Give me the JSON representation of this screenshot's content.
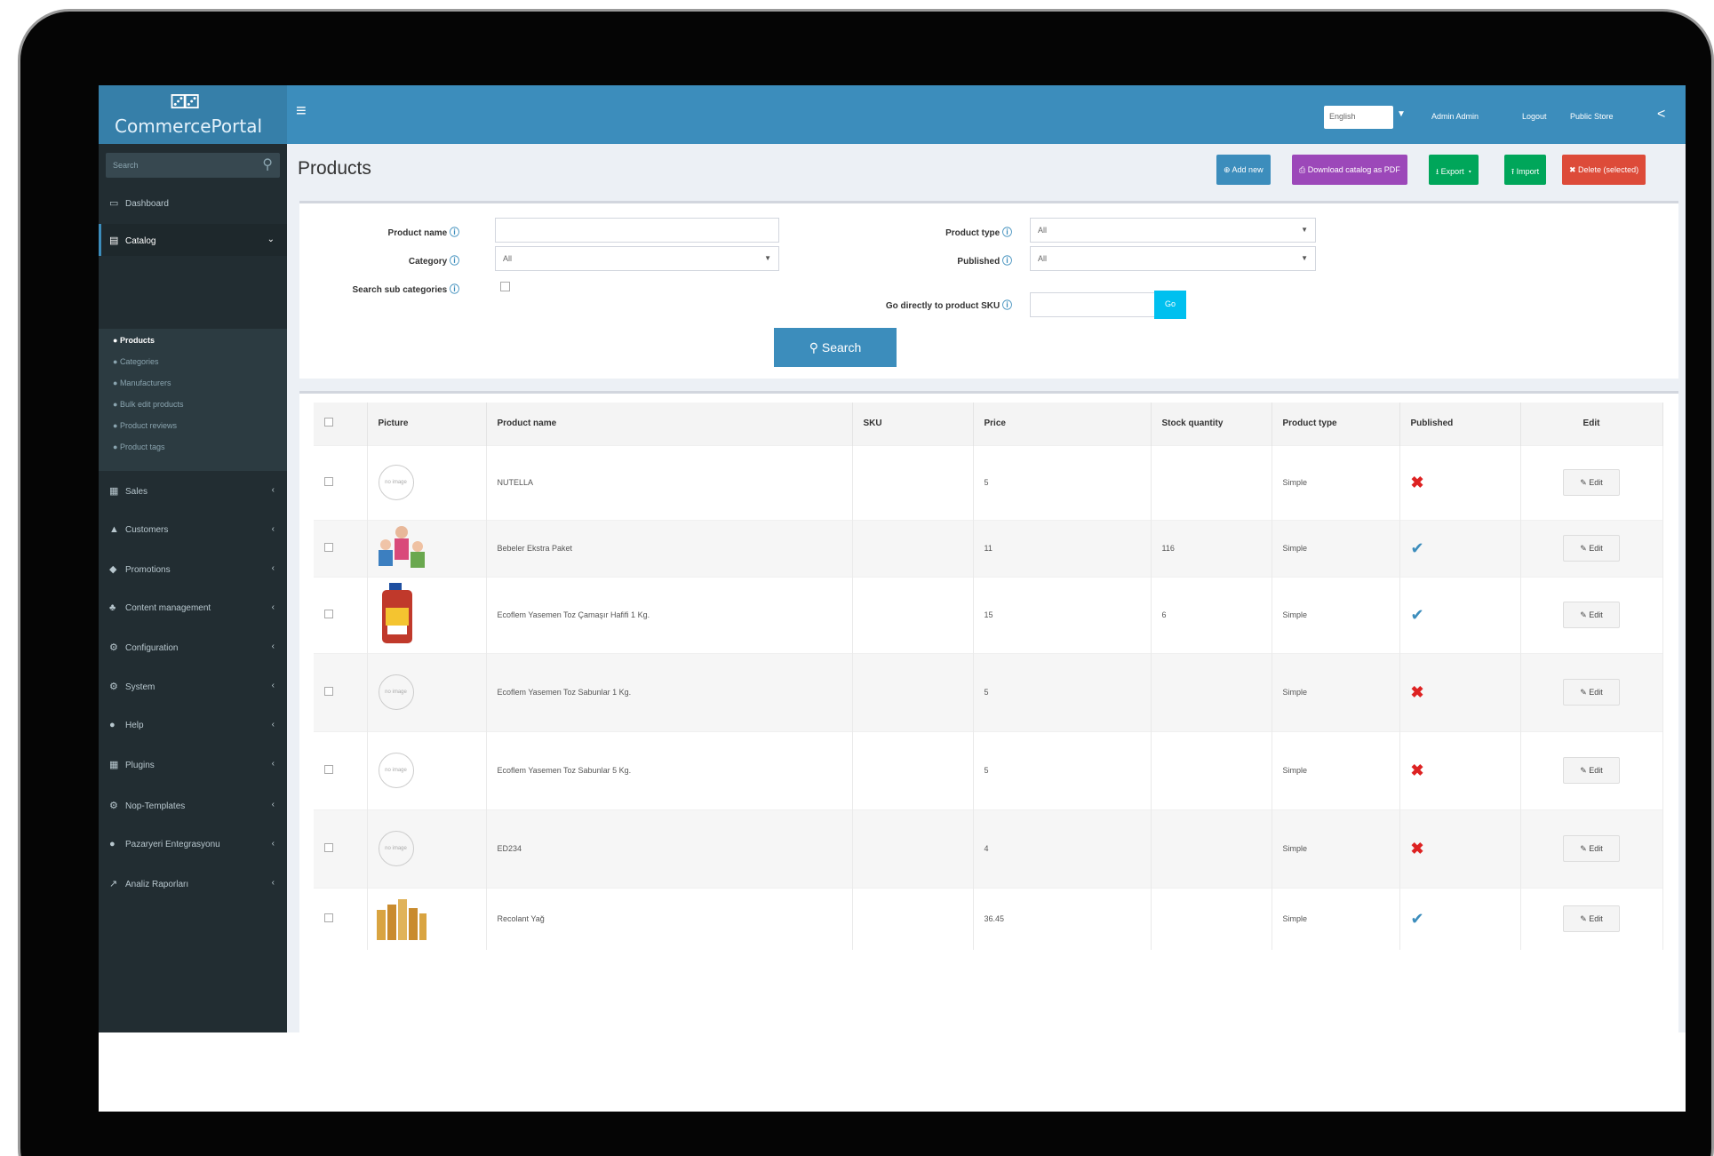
{
  "header": {
    "logo_icon": "⚂⚂",
    "logo_text": "CommercePortal",
    "menu_icon": "≡",
    "language": "English",
    "links": [
      "Admin Admin",
      "Logout",
      "Public Store"
    ],
    "share_icon": "<"
  },
  "sidebar": {
    "search_placeholder": "Search",
    "items": [
      {
        "label": "Dashboard",
        "icon": "▭"
      },
      {
        "label": "Catalog",
        "icon": "▤",
        "open": true
      },
      {
        "label": "Sales",
        "icon": "▦"
      },
      {
        "label": "Customers",
        "icon": "▲"
      },
      {
        "label": "Promotions",
        "icon": "◆"
      },
      {
        "label": "Content management",
        "icon": "♣"
      },
      {
        "label": "Configuration",
        "icon": "⚙"
      },
      {
        "label": "System",
        "icon": "⚙"
      },
      {
        "label": "Help",
        "icon": "●"
      },
      {
        "label": "Plugins",
        "icon": "▦"
      },
      {
        "label": "Nop-Templates",
        "icon": "⚙"
      },
      {
        "label": "Pazaryeri Entegrasyonu",
        "icon": "●"
      },
      {
        "label": "Analiz Raporları",
        "icon": "↗"
      }
    ],
    "submenu": [
      "Products",
      "Categories",
      "Manufacturers",
      "Bulk edit products",
      "Product reviews",
      "Product tags"
    ]
  },
  "page": {
    "title": "Products",
    "buttons": {
      "add_new": "⊕ Add new",
      "download_pdf": "⎙ Download catalog as PDF",
      "export": "⭳ Export",
      "import": "⭱ Import",
      "delete": "✖ Delete (selected)"
    }
  },
  "search": {
    "product_name_label": "Product name",
    "product_name_value": "",
    "category_label": "Category",
    "category_value": "All",
    "search_sub_label": "Search sub categories",
    "product_type_label": "Product type",
    "product_type_value": "All",
    "published_label": "Published",
    "published_value": "All",
    "sku_label": "Go directly to product SKU",
    "sku_value": "",
    "go_label": "Go",
    "search_button": "⚲ Search",
    "help_icon": "ⓘ"
  },
  "grid": {
    "columns": [
      "",
      "Picture",
      "Product name",
      "SKU",
      "Price",
      "Stock quantity",
      "Product type",
      "Published",
      "Edit"
    ],
    "edit_label": "✎ Edit",
    "rows": [
      {
        "picture": "no-image",
        "name": "NUTELLA",
        "sku": "",
        "price": "5",
        "stock": "",
        "type": "Simple",
        "published": false
      },
      {
        "picture": "family",
        "name": "Bebeler Ekstra Paket",
        "sku": "",
        "price": "11",
        "stock": "116",
        "type": "Simple",
        "published": true
      },
      {
        "picture": "detergent",
        "name": "Ecoflem Yasemen Toz Çamaşır Hafifi 1 Kg.",
        "sku": "",
        "price": "15",
        "stock": "6",
        "type": "Simple",
        "published": true
      },
      {
        "picture": "no-image",
        "name": "Ecoflem Yasemen Toz Sabunlar 1 Kg.",
        "sku": "",
        "price": "5",
        "stock": "",
        "type": "Simple",
        "published": false
      },
      {
        "picture": "no-image",
        "name": "Ecoflem Yasemen Toz Sabunlar 5 Kg.",
        "sku": "",
        "price": "5",
        "stock": "",
        "type": "Simple",
        "published": false
      },
      {
        "picture": "no-image",
        "name": "ED234",
        "sku": "",
        "price": "4",
        "stock": "",
        "type": "Simple",
        "published": false
      },
      {
        "picture": "bottles",
        "name": "Recolant Yağ",
        "sku": "",
        "price": "36.45",
        "stock": "",
        "type": "Simple",
        "published": true
      }
    ],
    "no_image_text": "no image"
  }
}
